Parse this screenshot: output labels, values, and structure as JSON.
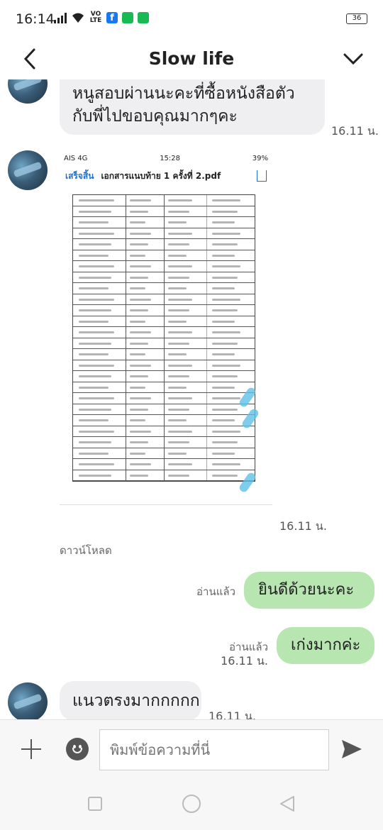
{
  "status_bar": {
    "time": "16:14",
    "volte": "VO LTE",
    "battery": "36",
    "icons": [
      "signal-icon",
      "wifi-icon",
      "volte-icon",
      "facebook-icon",
      "line-icon",
      "line-icon",
      "battery-icon"
    ]
  },
  "header": {
    "title": "Slow life",
    "back_icon": "chevron-left-icon",
    "menu_icon": "chevron-down-icon"
  },
  "messages": [
    {
      "side": "in",
      "text_line1": "หนูสอบผ่านนะคะที่ซื้อหนังสือตัว",
      "text_line2": "กับพี่ไปขอบคุณมากๆคะ",
      "time": "16.11 น."
    },
    {
      "side": "in",
      "type": "image",
      "time": "16.11 น.",
      "download_label": "ดาวน์โหลด",
      "image": {
        "status_left": "AIS 4G",
        "status_time": "15:28",
        "status_right": "39%",
        "done": "เสร็จสิ้น",
        "filename": "เอกสารแนบท้าย 1 ครั้งที่ 2.pdf"
      }
    },
    {
      "side": "out",
      "text": "ยินดีด้วยนะคะ",
      "read": "อ่านแล้ว"
    },
    {
      "side": "out",
      "text": "เก่งมากค่ะ",
      "read": "อ่านแล้ว",
      "time": "16.11 น."
    },
    {
      "side": "in",
      "text": "แนวตรงมากกกกก",
      "time": "16.11 น."
    }
  ],
  "input": {
    "placeholder": "พิมพ์ข้อความที่นี่"
  },
  "colors": {
    "outgoing_bubble": "#b7e6b1",
    "incoming_bubble": "#efeff1",
    "link_blue": "#1a6fd6"
  }
}
